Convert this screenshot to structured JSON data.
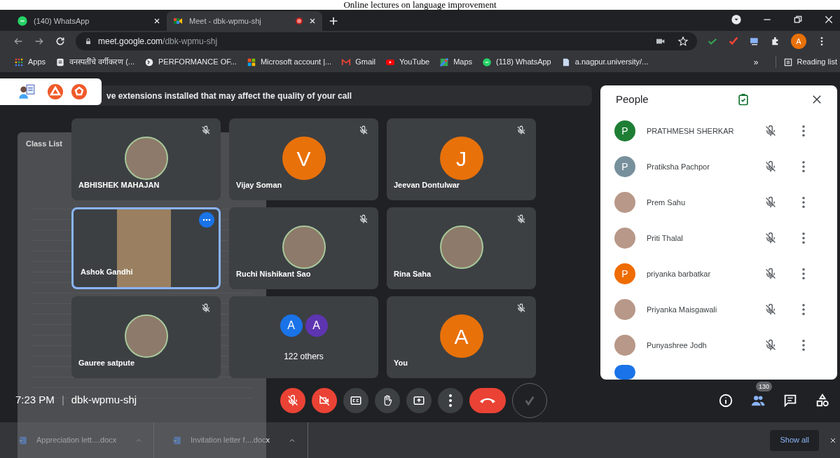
{
  "caption": "Online lectures on language improvement",
  "tabs": [
    {
      "title": "(140) WhatsApp",
      "selected": false,
      "recording": false
    },
    {
      "title": "Meet - dbk-wpmu-shj",
      "selected": true,
      "recording": true
    }
  ],
  "address": {
    "host": "meet.google.com",
    "path": "/dbk-wpmu-shj"
  },
  "profile_initial": "A",
  "bookmarks": [
    "Apps",
    "वनस्पतींचे वर्गीकरण (...",
    "PERFORMANCE OF...",
    "Microsoft account |...",
    "Gmail",
    "YouTube",
    "Maps",
    "(118) WhatsApp",
    "a.nagpur.university/..."
  ],
  "bookmarks_more": "»",
  "reading_list": "Reading list",
  "extension_banner": "ve extensions installed that may affect the quality of your call",
  "class_list": {
    "title": "Class List"
  },
  "tiles": [
    {
      "kind": "photo",
      "name": "ABHISHEK MAHAJAN",
      "muted": true,
      "speaking": false
    },
    {
      "kind": "initial",
      "name": "Vijay Soman",
      "initial": "V",
      "color": "#e8710a",
      "muted": true,
      "speaking": false
    },
    {
      "kind": "initial",
      "name": "Jeevan Dontulwar",
      "initial": "J",
      "color": "#e8710a",
      "muted": true,
      "speaking": false
    },
    {
      "kind": "video",
      "name": "Ashok Gandhi",
      "muted": false,
      "speaking": true
    },
    {
      "kind": "photo",
      "name": "Ruchi Nishikant Sao",
      "muted": true,
      "speaking": false
    },
    {
      "kind": "photo",
      "name": "Rina Saha",
      "muted": true,
      "speaking": false
    },
    {
      "kind": "photo",
      "name": "Gauree satpute",
      "muted": true,
      "speaking": false
    },
    {
      "kind": "others",
      "name": "122 others",
      "avatars": [
        {
          "initial": "A",
          "color": "#1a73e8"
        },
        {
          "initial": "A",
          "color": "#5e35b1"
        }
      ],
      "muted": false,
      "speaking": false
    },
    {
      "kind": "initial",
      "name": "You",
      "initial": "A",
      "color": "#e8710a",
      "muted": true,
      "speaking": false
    }
  ],
  "meeting_info": {
    "time": "7:23 PM",
    "separator": "|",
    "code": "dbk-wpmu-shj"
  },
  "controls": [
    {
      "kind": "mic",
      "off": true
    },
    {
      "kind": "camera",
      "off": true
    },
    {
      "kind": "captions",
      "off": false
    },
    {
      "kind": "hand",
      "off": false
    },
    {
      "kind": "present",
      "off": false
    },
    {
      "kind": "more",
      "off": false
    },
    {
      "kind": "hangup"
    },
    {
      "kind": "extension"
    }
  ],
  "side_buttons": [
    {
      "kind": "info",
      "selected": false
    },
    {
      "kind": "people",
      "selected": true,
      "badge": "130"
    },
    {
      "kind": "chat",
      "selected": false
    },
    {
      "kind": "activities",
      "selected": false
    }
  ],
  "people_panel": {
    "title": "People",
    "people": [
      {
        "name": "PRATHMESH SHERKAR",
        "kind": "initial",
        "initial": "P",
        "color": "#1e7e34"
      },
      {
        "name": "Pratiksha Pachpor",
        "kind": "initial",
        "initial": "P",
        "color": "#78909c"
      },
      {
        "name": "Prem Sahu",
        "kind": "photo"
      },
      {
        "name": "Priti Thalal",
        "kind": "photo"
      },
      {
        "name": "priyanka barbatkar",
        "kind": "initial",
        "initial": "P",
        "color": "#ef6c00"
      },
      {
        "name": "Priyanka Maisgawali",
        "kind": "photo"
      },
      {
        "name": "Punyashree Jodh",
        "kind": "photo"
      }
    ]
  },
  "downloads": [
    "Appreciation lett....docx",
    "Invitation letter f....docx"
  ],
  "show_all": "Show all"
}
